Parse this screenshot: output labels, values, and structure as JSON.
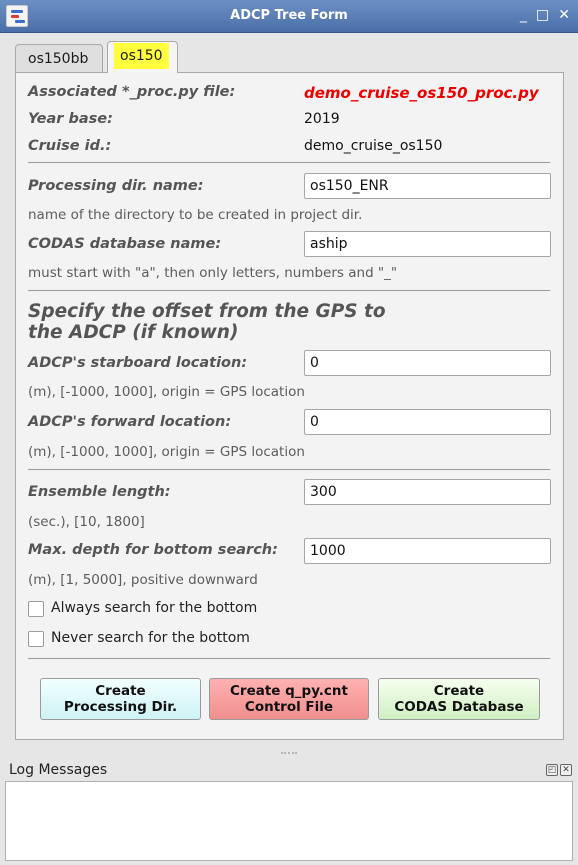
{
  "window": {
    "title": "ADCP Tree Form",
    "controls": [
      "_",
      "□",
      "✕"
    ]
  },
  "tabs": [
    {
      "label": "os150bb",
      "active": false
    },
    {
      "label": "os150",
      "active": true
    }
  ],
  "info": {
    "proc_file_label": "Associated *_proc.py file:",
    "proc_file_value": "demo_cruise_os150_proc.py",
    "year_base_label": "Year base:",
    "year_base_value": "2019",
    "cruise_id_label": "Cruise id.:",
    "cruise_id_value": "demo_cruise_os150"
  },
  "fields": {
    "proc_dir_label": "Processing dir. name:",
    "proc_dir_value": "os150_ENR",
    "proc_dir_hint": "name of the directory to be created in project dir.",
    "codas_label": "CODAS database name:",
    "codas_value": "aship",
    "codas_hint": "must start with \"a\", then only letters, numbers and \"_\""
  },
  "offset": {
    "heading_line1": "Specify the offset from the GPS to",
    "heading_line2": "the ADCP (if known)",
    "starboard_label": "ADCP's starboard location:",
    "starboard_value": "0",
    "starboard_hint": "(m), [-1000, 1000], origin = GPS location",
    "forward_label": "ADCP's forward location:",
    "forward_value": "0",
    "forward_hint": "(m), [-1000, 1000], origin = GPS location"
  },
  "ensemble": {
    "length_label": "Ensemble length:",
    "length_value": "300",
    "length_hint": "(sec.), [10, 1800]",
    "depth_label": "Max. depth for bottom search:",
    "depth_value": "1000",
    "depth_hint": "(m), [1, 5000], positive downward"
  },
  "checkboxes": {
    "always_label": "Always search for the bottom",
    "always_checked": false,
    "never_label": "Never search for the bottom",
    "never_checked": false
  },
  "buttons": {
    "create_dir_line1": "Create",
    "create_dir_line2": "Processing Dir.",
    "create_cnt_line1": "Create q_py.cnt",
    "create_cnt_line2": "Control File",
    "create_db_line1": "Create",
    "create_db_line2": "CODAS Database"
  },
  "log": {
    "title": "Log Messages",
    "content": ""
  },
  "colors": {
    "titlebar": "#5a7fb8",
    "highlight": "#ffff3d",
    "proc_file_red": "#ee0000",
    "btn_dir": "#cdf2f6",
    "btn_cnt": "#f08f8f",
    "btn_db": "#cfefc3"
  }
}
